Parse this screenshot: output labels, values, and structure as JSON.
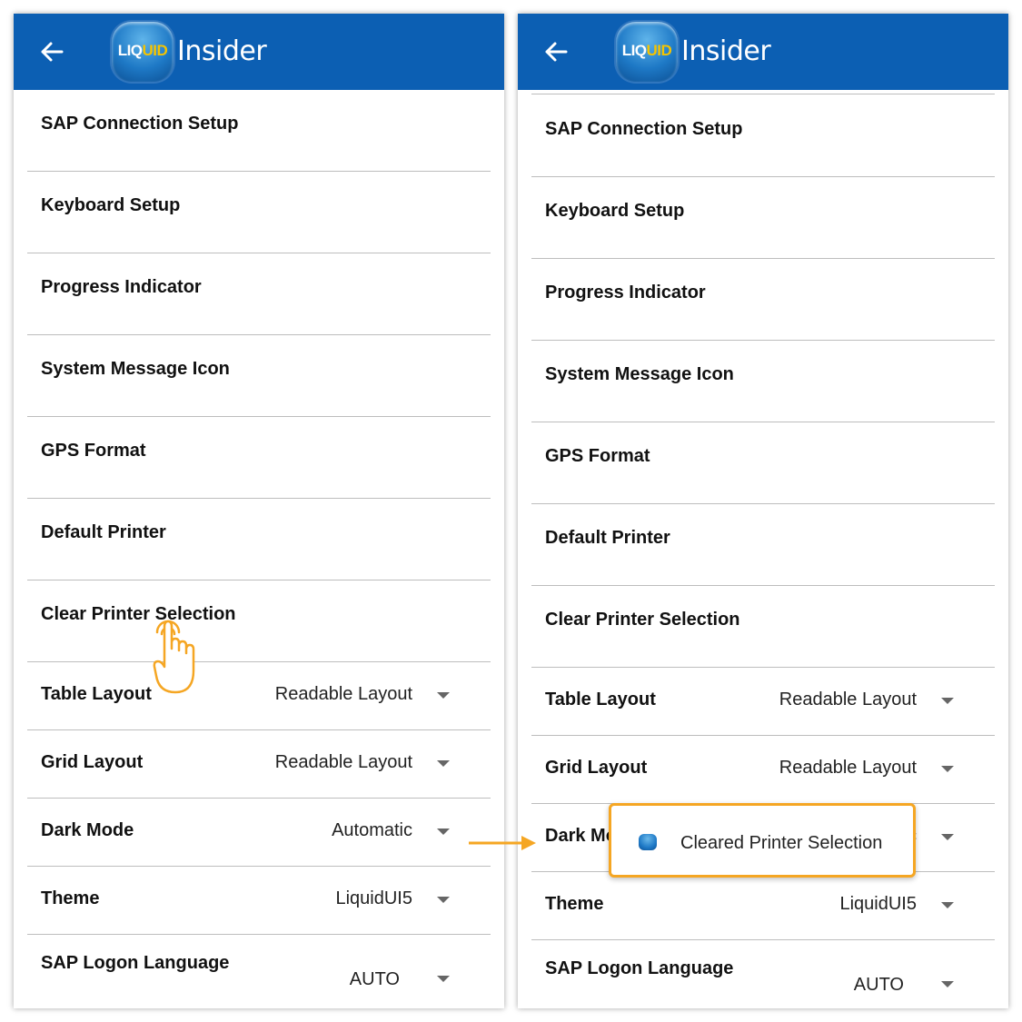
{
  "app": {
    "logo_liquid": "LIQ",
    "logo_ui": "UID",
    "title": "Insider"
  },
  "settings": {
    "sap_connection_setup": "SAP Connection Setup",
    "keyboard_setup": "Keyboard Setup",
    "progress_indicator": "Progress Indicator",
    "system_message_icon": "System Message Icon",
    "gps_format": "GPS Format",
    "default_printer": "Default Printer",
    "clear_printer_selection": "Clear Printer Selection",
    "table_layout": {
      "label": "Table Layout",
      "value": "Readable Layout"
    },
    "grid_layout": {
      "label": "Grid Layout",
      "value": "Readable Layout"
    },
    "dark_mode": {
      "label": "Dark Mode",
      "value": "Automatic"
    },
    "theme": {
      "label": "Theme",
      "value": "LiquidUI5"
    },
    "sap_logon_language": {
      "label": "SAP Logon Language",
      "value": "AUTO"
    }
  },
  "toast": {
    "message": "Cleared Printer Selection"
  },
  "colors": {
    "appbar": "#0c5fb3",
    "highlight": "#f5a623"
  },
  "icons": [
    "back-arrow-icon",
    "liquid-ui-logo",
    "dropdown-caret-icon",
    "tap-hand-icon",
    "arrow-right-icon"
  ]
}
